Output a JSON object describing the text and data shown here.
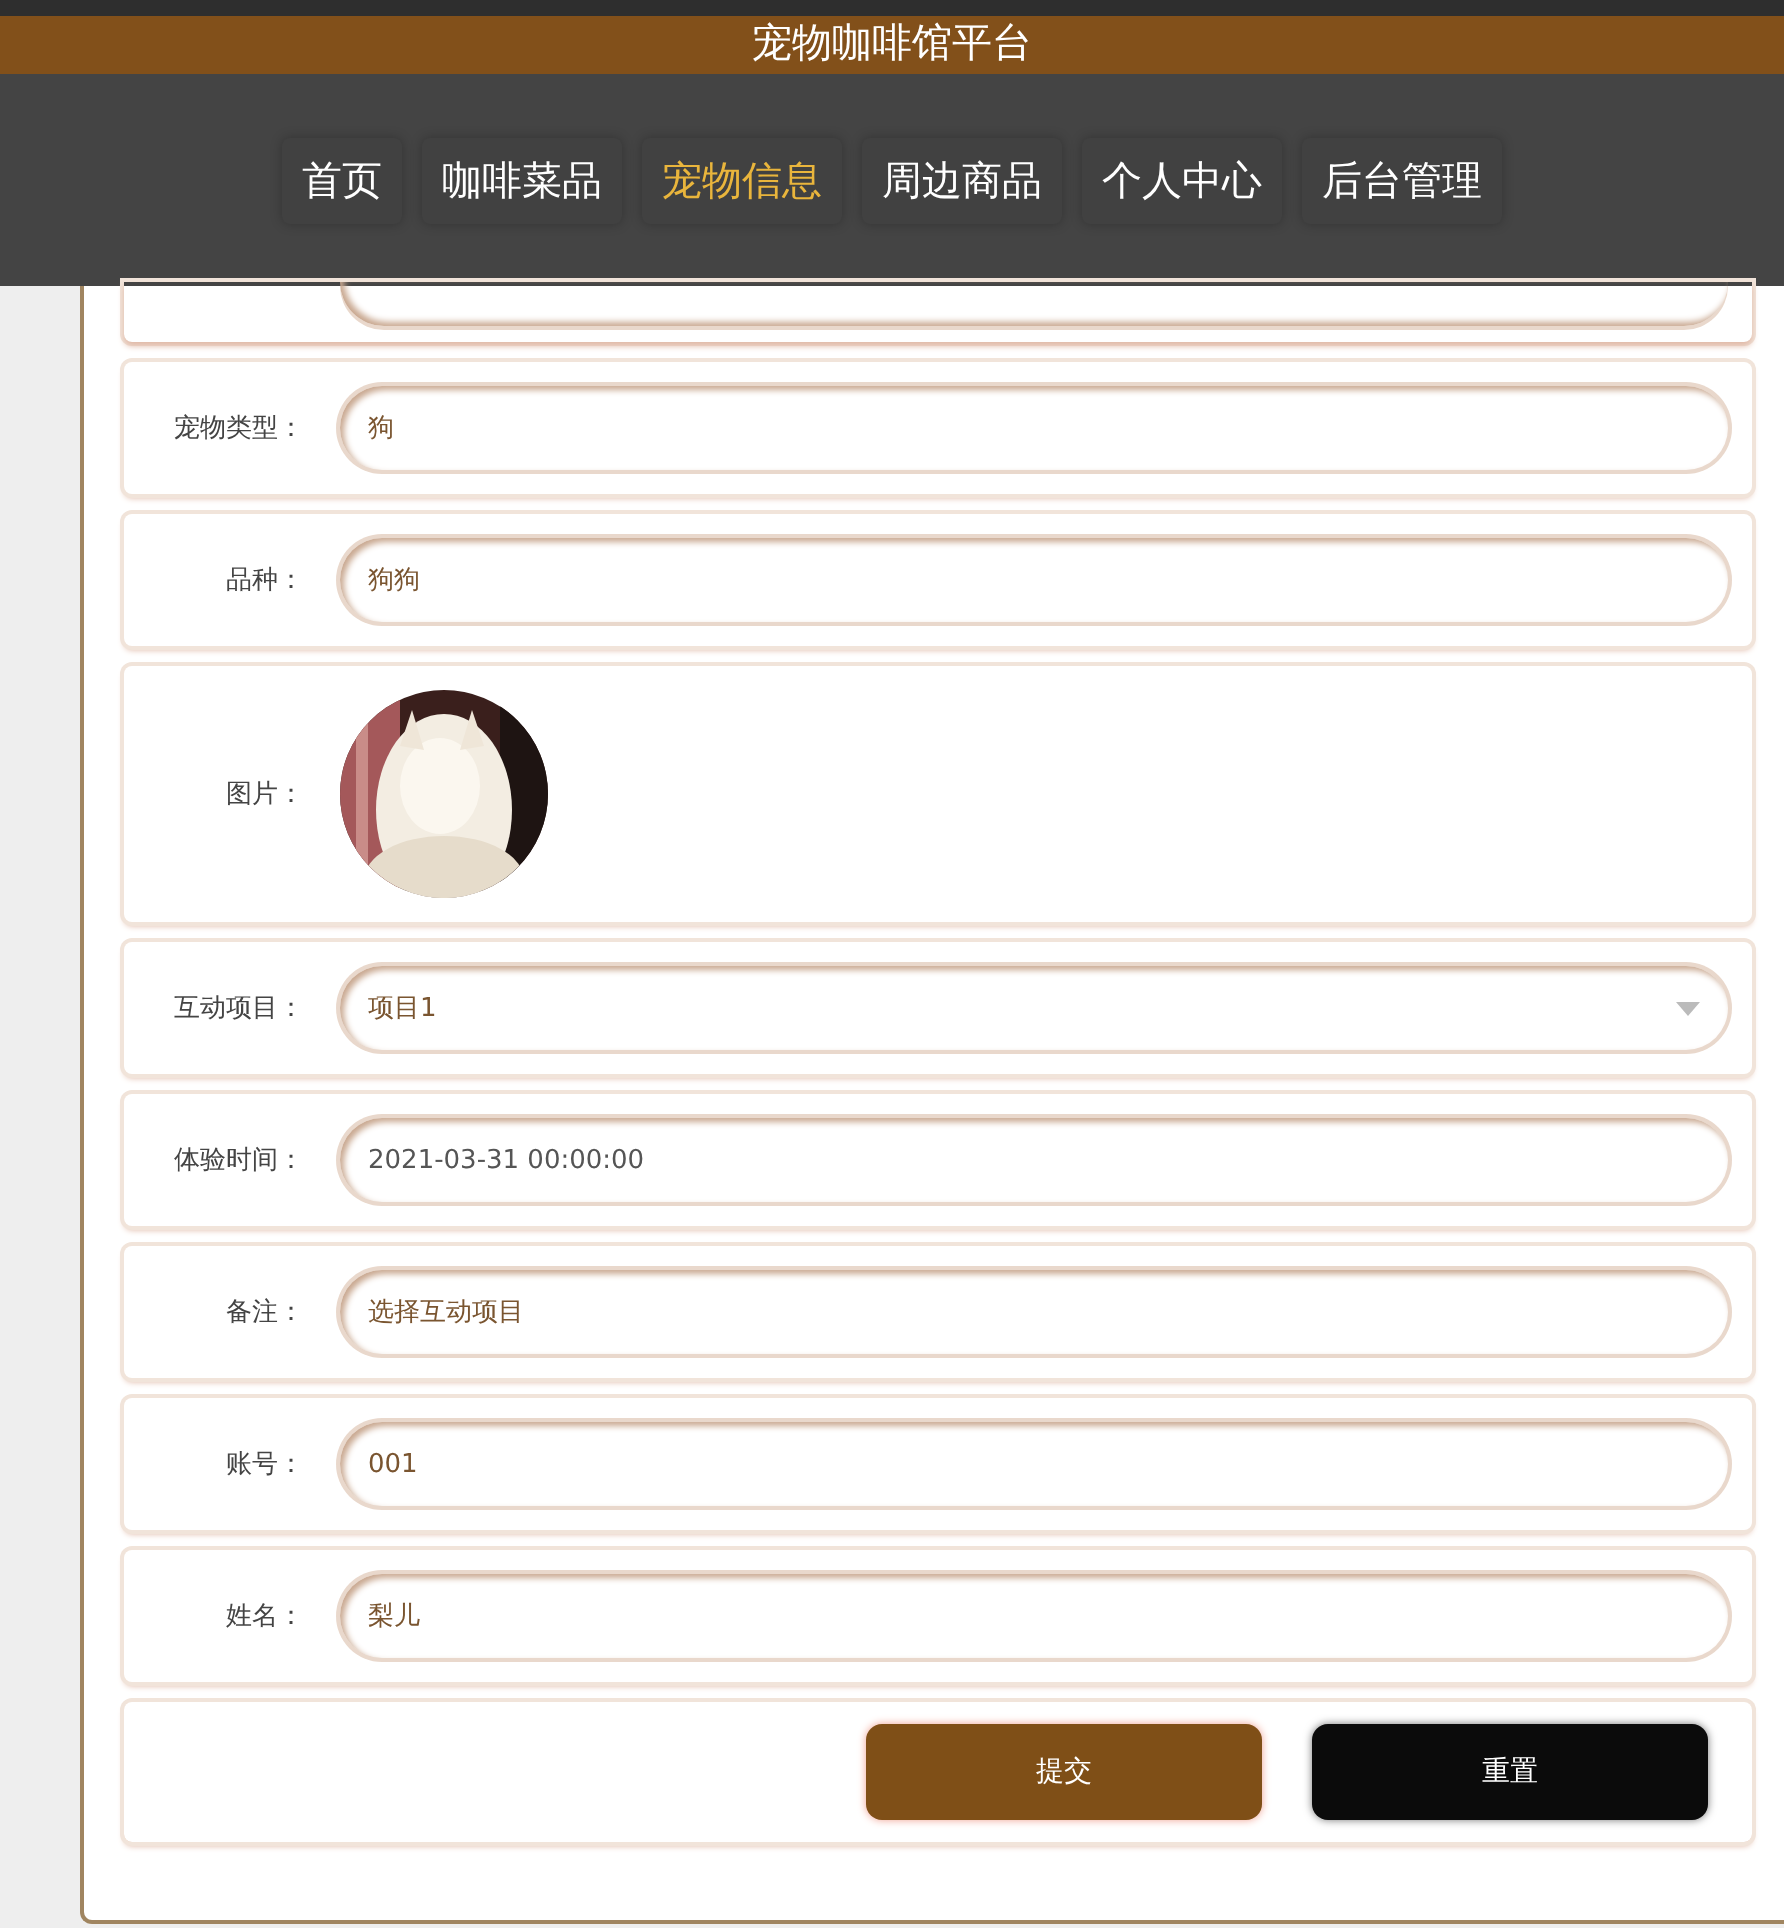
{
  "header": {
    "title": "宠物咖啡馆平台"
  },
  "nav": [
    {
      "label": "首页",
      "selected": false
    },
    {
      "label": "咖啡菜品",
      "selected": false
    },
    {
      "label": "宠物信息",
      "selected": true
    },
    {
      "label": "周边商品",
      "selected": false
    },
    {
      "label": "个人中心",
      "selected": false
    },
    {
      "label": "后台管理",
      "selected": false
    }
  ],
  "form": [
    {
      "kind": "cut"
    },
    {
      "kind": "text",
      "label": "宠物类型：",
      "value": "狗"
    },
    {
      "kind": "text",
      "label": "品种：",
      "value": "狗狗"
    },
    {
      "label": "图片："
    },
    {
      "kind": "select",
      "label": "互动项目：",
      "value": "项目1"
    },
    {
      "kind": "text",
      "label": "体验时间：",
      "value": "2021-03-31 00:00:00"
    },
    {
      "kind": "text",
      "label": "备注：",
      "value": "选择互动项目"
    },
    {
      "kind": "text",
      "label": "账号：",
      "value": "001"
    },
    {
      "kind": "text",
      "label": "姓名：",
      "value": "梨儿"
    }
  ],
  "buttons": [
    {
      "kind": "primary",
      "label": "提交"
    },
    {
      "kind": "dark",
      "label": "重置"
    }
  ]
}
